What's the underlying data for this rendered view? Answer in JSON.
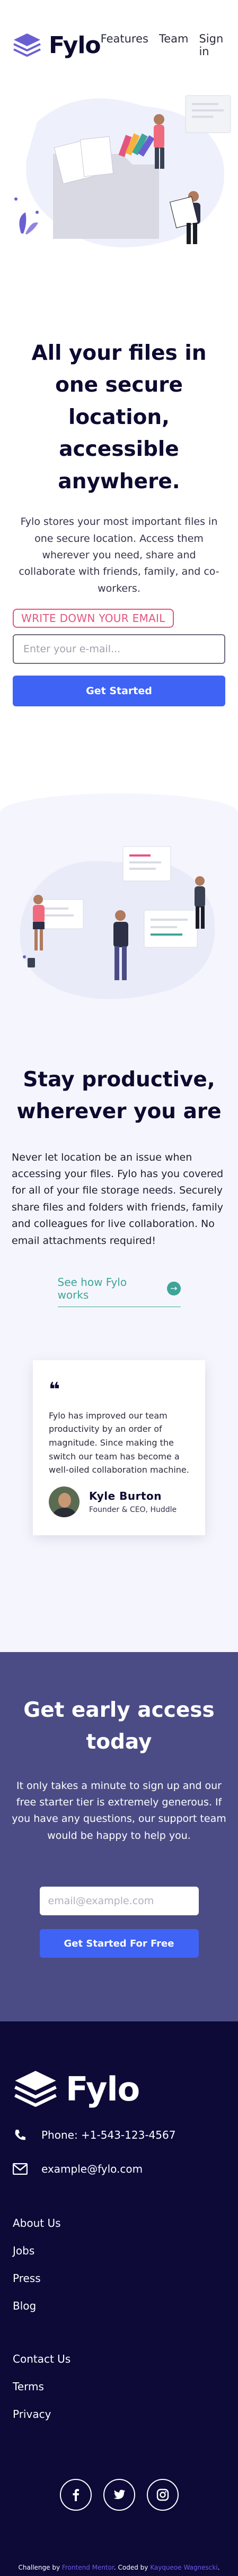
{
  "header": {
    "logo_text": "Fylo",
    "nav": [
      "Features",
      "Team",
      "Sign in"
    ]
  },
  "hero": {
    "title": "All your files in one secure location, accessible anywhere.",
    "lead": "Fylo stores your most important files in one secure location. Access them wherever you need, share and collaborate with friends, family, and co-workers.",
    "email_label": "WRITE DOWN YOUR EMAIL",
    "email_placeholder": "Enter your e-mail...",
    "cta": "Get Started"
  },
  "productive": {
    "title": "Stay productive, wherever you are",
    "body": "Never let location be an issue when accessing your files. Fylo has you covered for all of your file storage needs. Securely share files and folders with friends, family and colleagues for live collaboration. No email attachments required!",
    "link": "See how Fylo works",
    "arrow": "→",
    "testimonial": {
      "quote_mark": "❝",
      "text": "Fylo has improved our team productivity by an order of magnitude. Since making the switch our team has become a well-oiled collaboration machine.",
      "name": "Kyle Burton",
      "role": "Founder & CEO, Huddle"
    }
  },
  "access": {
    "title": "Get early access today",
    "body": "It only takes a minute to sign up and our free starter tier is extremely generous. If you have any questions, our support team would be happy to help you.",
    "email_placeholder": "email@example.com",
    "cta": "Get Started For Free"
  },
  "footer": {
    "logo_text": "Fylo",
    "phone": "Phone: +1-543-123-4567",
    "email": "example@fylo.com",
    "links_1": [
      "About Us",
      "Jobs",
      "Press",
      "Blog"
    ],
    "links_2": [
      "Contact Us",
      "Terms",
      "Privacy"
    ],
    "socials": [
      "facebook-icon",
      "twitter-icon",
      "instagram-icon"
    ],
    "attribution": {
      "prefix": "Challenge by",
      "challenge_link": "Frontend Mentor",
      "middle": ". Coded by",
      "coder_link": "Kayqueoe Wagnescki",
      "suffix": "."
    }
  },
  "colors": {
    "primary": "#3f63f4",
    "accent_pink": "#e5547f",
    "teal": "#3ea598",
    "access_bg": "#4b4c85",
    "footer_bg": "#0d0a38"
  }
}
